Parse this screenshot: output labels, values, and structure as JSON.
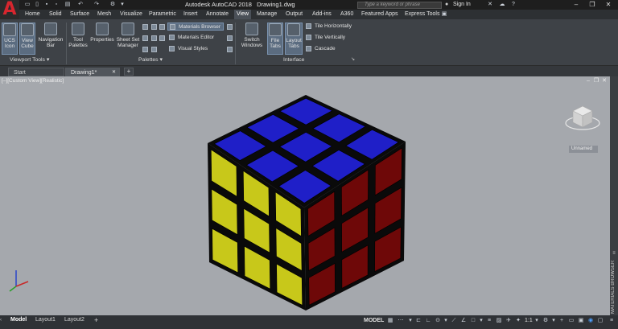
{
  "app": {
    "title": "Autodesk AutoCAD 2018",
    "file": "Drawing1.dwg",
    "search_placeholder": "Type a keyword or phrase",
    "sign_in": "Sign In"
  },
  "ribbon": {
    "tabs": [
      "Home",
      "Solid",
      "Surface",
      "Mesh",
      "Visualize",
      "Parametric",
      "Insert",
      "Annotate",
      "View",
      "Manage",
      "Output",
      "Add-ins",
      "A360",
      "Featured Apps",
      "Express Tools"
    ],
    "active_tab": "View",
    "viewport_tools": {
      "ucs_icon": "UCS Icon",
      "view_cube": "View Cube",
      "navigation_bar": "Navigation Bar",
      "panel": "Viewport Tools"
    },
    "palettes": {
      "tool_palettes": "Tool Palettes",
      "properties": "Properties",
      "sheet_set_manager": "Sheet Set Manager",
      "panel": "Palettes",
      "materials_browser": "Materials Browser",
      "materials_editor": "Materials Editor",
      "visual_styles": "Visual Styles"
    },
    "interface": {
      "switch_windows": "Switch Windows",
      "file_tabs": "File Tabs",
      "layout_tabs": "Layout Tabs",
      "tile_horizontally": "Tile Horizontally",
      "tile_vertically": "Tile Vertically",
      "cascade": "Cascade",
      "panel": "Interface"
    }
  },
  "doc_tabs": [
    "Start",
    "Drawing1*"
  ],
  "viewport": {
    "label": "[–][Custom View][Realistic]",
    "viewcube_label": "Unnamed",
    "side_palette": "MATERIALS BROWSER"
  },
  "layout_tabs": [
    "Model",
    "Layout1",
    "Layout2"
  ],
  "status": {
    "model": "MODEL",
    "scale": "1:1"
  },
  "colors": {
    "cube_top": "#1f1fc8",
    "cube_left": "#c8c81a",
    "cube_right": "#6e0808"
  }
}
